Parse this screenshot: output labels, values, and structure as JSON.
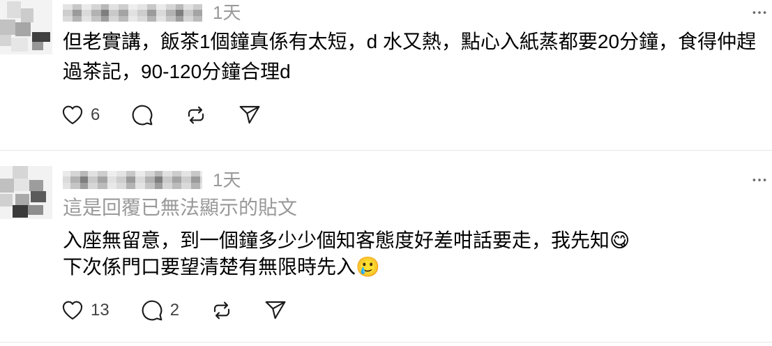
{
  "theme": {
    "background": "#ffffff",
    "text": "#000000",
    "secondary": "#999999",
    "icon": "#1a1a1a",
    "count": "#424242",
    "muted": "#6b6b6b",
    "divider": "#e5e5e5"
  },
  "posts": [
    {
      "timestamp": "1天",
      "more_icon": "more-horizontal-icon",
      "text_lines": [
        "但老實講，飯茶1個鐘真係有太短，d 水又熱，點心入紙蒸都要20分鐘，食得仲趕",
        "過茶記，90-120分鐘合理d"
      ],
      "actions": {
        "like": {
          "icon": "heart-icon",
          "count": "6"
        },
        "reply": {
          "icon": "comment-icon"
        },
        "repost": {
          "icon": "repost-icon"
        },
        "share": {
          "icon": "share-icon"
        }
      }
    },
    {
      "timestamp": "1天",
      "more_icon": "more-horizontal-icon",
      "reply_notice": "這是回覆已無法顯示的貼文",
      "text_lines": [
        "入座無留意，到一個鐘多少少個知客態度好差咁話要走，我先知😋",
        "下次係門口要望清楚有無限時先入🥲"
      ],
      "actions": {
        "like": {
          "icon": "heart-icon",
          "count": "13"
        },
        "reply": {
          "icon": "comment-icon",
          "count": "2"
        },
        "repost": {
          "icon": "repost-icon"
        },
        "share": {
          "icon": "share-icon"
        }
      }
    }
  ]
}
